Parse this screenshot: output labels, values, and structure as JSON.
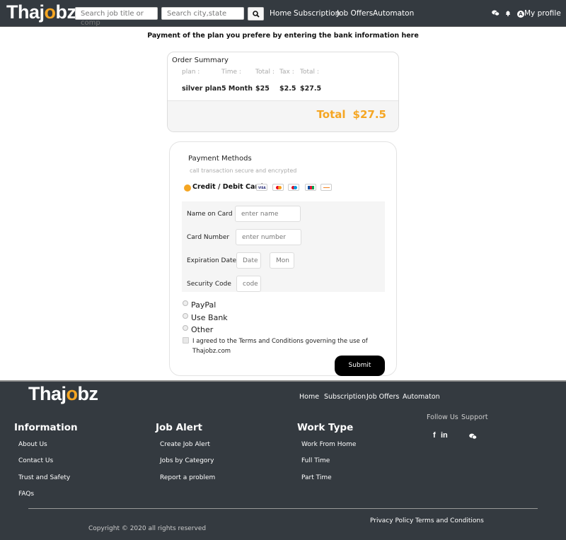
{
  "brand": {
    "name_prefix": "Thaj",
    "name_o": "o",
    "name_suffix": "bz",
    "accent": "#f5a623",
    "nav_bg": "#343a40"
  },
  "navbar": {
    "search_job_placeholder": "Search job title or comp",
    "search_city_placeholder": "Search city,state",
    "links": [
      "Home",
      "Subscription",
      "Job Offers",
      "Automaton"
    ],
    "profile_label": "My profile",
    "icons": [
      "chat-icon",
      "bell-icon",
      "user-icon",
      "search-icon"
    ]
  },
  "page": {
    "heading": "Payment of the plan you prefere by entering the bank information here"
  },
  "order_summary": {
    "title": "Order Summary",
    "headers": [
      "plan :",
      "Time :",
      "Total :",
      "Tax :",
      "Total :"
    ],
    "values": [
      "silver plan",
      "5 Month",
      "$25",
      "$2.5",
      "$27.5"
    ],
    "total_label": "Total",
    "total_value": "$27.5"
  },
  "payment": {
    "title": "Payment Methods",
    "subtitle": "call transaction secure and encrypted",
    "card_option": "Credit / Debit Card",
    "card_logos": [
      "visa",
      "mastercard",
      "maestro",
      "jcb",
      "discover"
    ],
    "fields": [
      {
        "label": "Name on Card",
        "placeholder": "enter name"
      },
      {
        "label": "Card Number",
        "placeholder": "enter number"
      },
      {
        "label": "Expiration Date",
        "placeholder": "Date",
        "placeholder2": "Mon"
      },
      {
        "label": "Security Code",
        "placeholder": "code"
      }
    ],
    "other_methods": [
      "PayPal",
      "Use Bank",
      "Other"
    ],
    "terms": "I agreed to the Terms and Conditions governing the use of Thajobz.com",
    "submit": "Submit"
  },
  "footer": {
    "nav": [
      "Home",
      "Subscription",
      "Job Offers",
      "Automaton"
    ],
    "columns": [
      {
        "heading": "Information",
        "links": [
          "About Us",
          "Contact Us",
          "Trust and Safety",
          "FAQs"
        ]
      },
      {
        "heading": "Job Alert",
        "links": [
          "Create Job Alert",
          "Jobs by Category",
          "Report a problem"
        ]
      },
      {
        "heading": "Work Type",
        "links": [
          "Work From Home",
          "Full Time",
          "Part Time"
        ]
      }
    ],
    "follow_us": "Follow Us",
    "support": "Support",
    "social_icons": [
      "facebook-icon",
      "linkedin-icon",
      "chat-icon"
    ],
    "copyright": "Copyright © 2020 all rights reserved",
    "bottom_links": [
      "Privacy Policy",
      "Terms and Conditions"
    ]
  }
}
